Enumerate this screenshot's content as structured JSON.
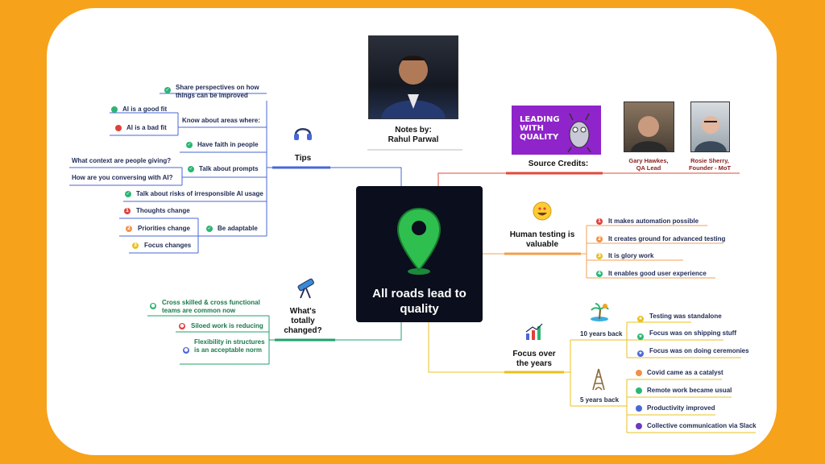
{
  "center": {
    "title": "All roads lead to quality"
  },
  "notes": {
    "title": "Notes by:",
    "name": "Rahul Parwal"
  },
  "credits": {
    "title": "Source Credits:",
    "logo_text": [
      "LEADING",
      "WITH",
      "QUALITY"
    ],
    "people": [
      {
        "name": "Gary Hawkes,",
        "role": "QA Lead"
      },
      {
        "name": "Rosie Sherry,",
        "role": "Founder - MoT"
      }
    ]
  },
  "tips": {
    "title": "Tips",
    "items": {
      "share": "Share perspectives on how things can be improved",
      "know": "Know about areas where:",
      "good_fit": "AI is a good fit",
      "bad_fit": "AI is a bad fit",
      "faith": "Have faith in people",
      "prompts": "Talk about prompts",
      "context": "What context are people giving?",
      "conversing": "How are you conversing with AI?",
      "risks": "Talk about risks of irresponsible AI usage",
      "adaptable": "Be adaptable",
      "thoughts": "Thoughts change",
      "priorities": "Priorities change",
      "focus": "Focus changes"
    },
    "numbers": [
      "1",
      "2",
      "3"
    ]
  },
  "changed": {
    "title": "What's totally changed?",
    "items": [
      "Cross skilled & cross functional teams are common now",
      "Siloed work is reducing",
      "Flexibility in structures is an acceptable norm"
    ]
  },
  "human": {
    "title": "Human testing is valuable",
    "items": [
      "It makes automation possible",
      "It creates ground for advanced testing",
      "It is glory work",
      "It enables good user experience"
    ],
    "numbers": [
      "1",
      "2",
      "3",
      "4"
    ]
  },
  "focus": {
    "title": "Focus over the years",
    "ten": {
      "label": "10 years back",
      "items": [
        "Testing was standalone",
        "Focus was on shipping stuff",
        "Focus was on doing ceremonies"
      ]
    },
    "five": {
      "label": "5 years back",
      "items": [
        "Covid came as a catalyst",
        "Remote work became usual",
        "Productivity improved",
        "Collective communication via Slack"
      ]
    }
  },
  "colors": {
    "page_bg": "#f7a21b",
    "center_bg": "#0b0e1c",
    "tips_branch": "#4a67d6",
    "changed_branch": "#22a06b",
    "human_branch": "#f0a050",
    "focus_branch": "#e8c020",
    "credits_branch": "#e04a3a"
  }
}
